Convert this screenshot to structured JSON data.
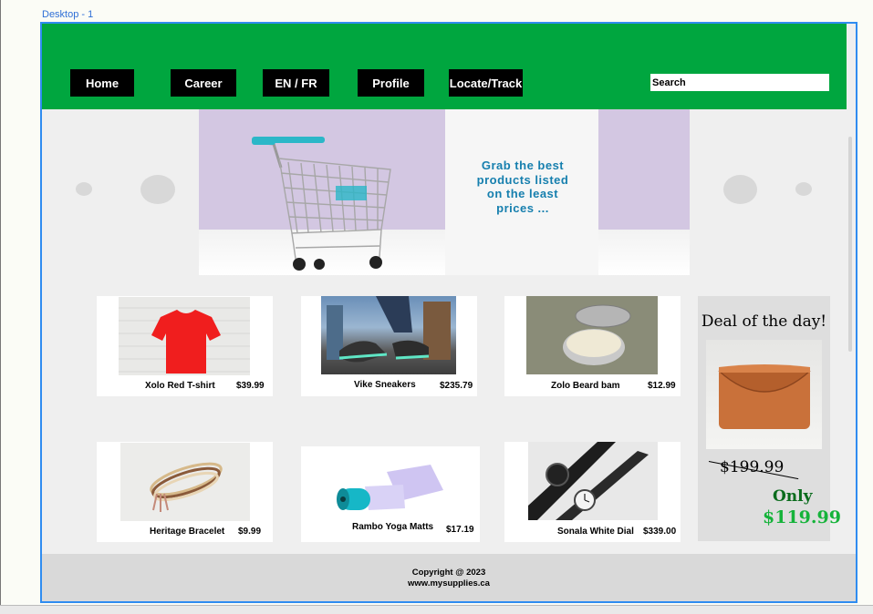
{
  "frame_label": "Desktop - 1",
  "colors": {
    "header": "#00a63f",
    "nav_button": "#000000",
    "accent_text": "#167fae",
    "deal_old": "#000000",
    "deal_new": "#15b33a",
    "deal_only": "#0a6b1c"
  },
  "nav": [
    {
      "label": "Home"
    },
    {
      "label": "Career"
    },
    {
      "label": "EN / FR"
    },
    {
      "label": "Profile"
    },
    {
      "label": "Locate/Track"
    }
  ],
  "search": {
    "placeholder": "Search",
    "value": ""
  },
  "banner": {
    "tagline_lines": [
      "Grab the best",
      "products listed",
      "on the least",
      "prices ..."
    ]
  },
  "products": [
    {
      "name": "Xolo Red T-shirt",
      "price": "$39.99",
      "image": "red-tshirt"
    },
    {
      "name": "Vike Sneakers",
      "price": "$235.79",
      "image": "sneakers"
    },
    {
      "name": "Zolo Beard bam",
      "price": "$12.99",
      "image": "beard-balm-tin"
    },
    {
      "name": "Heritage Bracelet",
      "price": "$9.99",
      "image": "bracelet"
    },
    {
      "name": "Rambo Yoga Matts",
      "price": "$17.19",
      "image": "yoga-mat"
    },
    {
      "name": "Sonala White Dial",
      "price": "$339.00",
      "image": "wristwatch"
    }
  ],
  "deal": {
    "title": "Deal of the day!",
    "old_price": "$199.99",
    "only_label": "Only",
    "new_price": "$119.99",
    "image": "leather-clutch"
  },
  "footer": {
    "copyright": "Copyright @ 2023",
    "website": "www.mysupplies.ca"
  }
}
